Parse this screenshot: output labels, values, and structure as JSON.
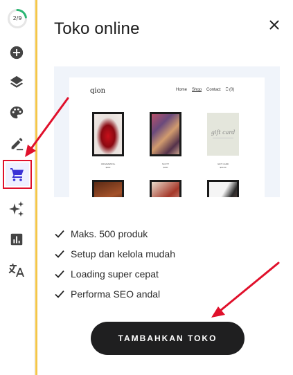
{
  "sidebar": {
    "progress": {
      "text": "2/9",
      "completed": 2,
      "total": 9,
      "color": "#2bb673"
    },
    "items": [
      {
        "icon": "add-circle-icon"
      },
      {
        "icon": "layers-icon"
      },
      {
        "icon": "palette-icon"
      },
      {
        "icon": "edit-pencil-icon"
      },
      {
        "icon": "shopping-cart-icon",
        "active": true
      },
      {
        "icon": "sparkles-icon"
      },
      {
        "icon": "bar-chart-icon"
      },
      {
        "icon": "translate-icon"
      }
    ],
    "accent_color": "#f3c64a",
    "active_color": "#3b33d6"
  },
  "panel": {
    "title": "Toko online",
    "close_icon": "close-icon",
    "preview": {
      "logo": "qion",
      "nav": [
        "Home",
        "Shop",
        "Contact",
        "⎕ (0)"
      ],
      "products": [
        {
          "caption": "ORNAMENTAL\n$000"
        },
        {
          "caption": "SCOTT\n$000"
        },
        {
          "caption": "GIFT CARD\n$00.00",
          "title": "gift card"
        }
      ]
    },
    "features": [
      "Maks. 500 produk",
      "Setup dan kelola mudah",
      "Loading super cepat",
      "Performa SEO andal"
    ],
    "cta_label": "TAMBAHKAN TOKO"
  },
  "annotation_color": "#e0102b"
}
